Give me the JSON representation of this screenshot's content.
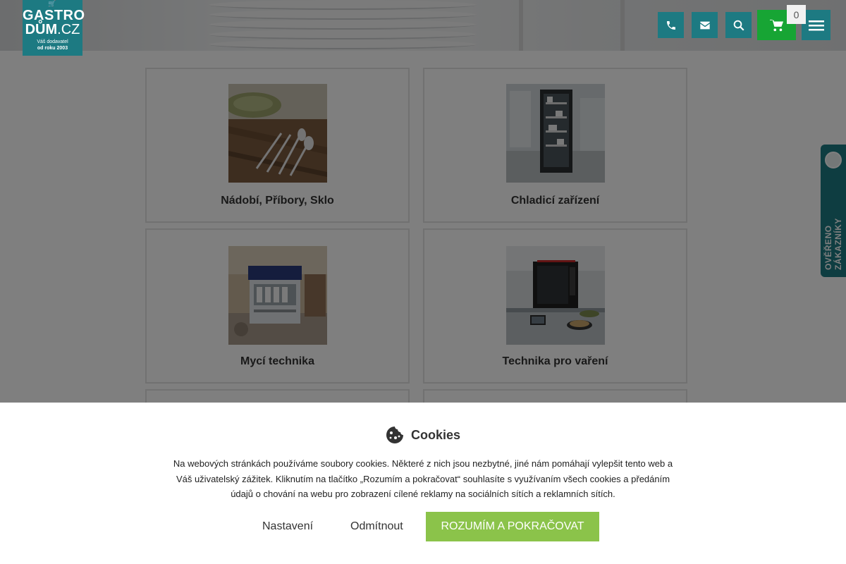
{
  "header": {
    "logo": {
      "line1": "GASTRO",
      "line2_main": "DŮM",
      "line2_suffix": ".CZ",
      "tagline1": "Váš dodavatel",
      "tagline2": "od roku 2003"
    },
    "icons": {
      "phone": "phone-icon",
      "email": "envelope-icon",
      "search": "search-icon",
      "cart": "cart-icon",
      "menu": "hamburger-icon"
    },
    "cart_count": "0",
    "accent_color": "#1d7a82",
    "cart_color": "#17a534"
  },
  "categories": [
    {
      "label": "Nádobí, Příbory, Sklo"
    },
    {
      "label": "Chladicí zařízení"
    },
    {
      "label": "Mycí technika"
    },
    {
      "label": "Technika pro vaření"
    }
  ],
  "side_badge": {
    "text": "OVĚŘENO ZÁKAZNÍKY"
  },
  "cookies": {
    "title": "Cookies",
    "text": "Na webových stránkách používáme soubory cookies. Některé z nich jsou nezbytné, jiné nám pomáhají vylepšit tento web a Váš uživatelský zážitek. Kliknutím na tlačítko „Rozumím a pokračovat“ souhlasíte s využívaním všech cookies a předáním údajů o chování na webu pro zobrazení cílené reklamy na sociálních sítích a reklamních sítích.",
    "settings_label": "Nastavení",
    "decline_label": "Odmítnout",
    "accept_label": "ROZUMÍM A POKRAČOVAT",
    "accept_color": "#8bc34a"
  }
}
